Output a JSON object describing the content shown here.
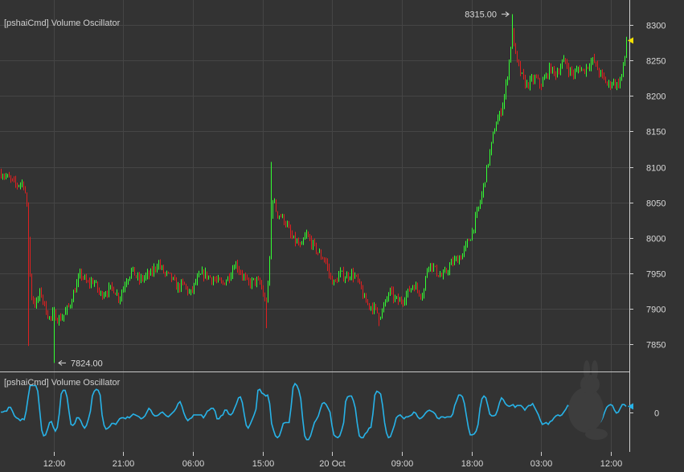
{
  "colors": {
    "background": "#333333",
    "grid": "#454545",
    "up": "#33ff33",
    "down": "#e02020",
    "oscillator": "#27b3e8",
    "axis_text": "#d8d8d8",
    "last_price_marker": "#f2e000",
    "osc_marker": "#27b3e8"
  },
  "chart_data": [
    {
      "type": "candlestick",
      "title": "[pshaiCmd] Volume Oscillator",
      "x_ticks": [
        "12:00",
        "21:00",
        "06:00",
        "15:00",
        "20 Oct",
        "09:00",
        "18:00",
        "03:00",
        "12:00"
      ],
      "y_ticks": [
        7850,
        7900,
        7950,
        8000,
        8050,
        8100,
        8150,
        8200,
        8250,
        8300
      ],
      "ylim": [
        7812,
        8335
      ],
      "annotations": [
        {
          "text": "8315.00",
          "value": 8315,
          "arrow": "right"
        },
        {
          "text": "7824.00",
          "value": 7824,
          "arrow": "left"
        }
      ],
      "last_value": 8278,
      "anchors": [
        [
          0,
          8092
        ],
        [
          8,
          8086
        ],
        [
          14,
          8080
        ],
        [
          20,
          8074
        ],
        [
          26,
          8078
        ],
        [
          30,
          8075
        ],
        [
          34,
          8030
        ],
        [
          38,
          7920
        ],
        [
          44,
          7905
        ],
        [
          50,
          7925
        ],
        [
          56,
          7900
        ],
        [
          62,
          7885
        ],
        [
          66,
          7895
        ],
        [
          72,
          7885
        ],
        [
          78,
          7890
        ],
        [
          86,
          7905
        ],
        [
          92,
          7925
        ],
        [
          100,
          7950
        ],
        [
          108,
          7935
        ],
        [
          116,
          7940
        ],
        [
          124,
          7920
        ],
        [
          132,
          7925
        ],
        [
          140,
          7930
        ],
        [
          148,
          7915
        ],
        [
          156,
          7940
        ],
        [
          164,
          7955
        ],
        [
          172,
          7940
        ],
        [
          180,
          7945
        ],
        [
          188,
          7950
        ],
        [
          196,
          7965
        ],
        [
          204,
          7950
        ],
        [
          212,
          7945
        ],
        [
          220,
          7930
        ],
        [
          228,
          7935
        ],
        [
          236,
          7920
        ],
        [
          244,
          7940
        ],
        [
          252,
          7950
        ],
        [
          260,
          7945
        ],
        [
          268,
          7940
        ],
        [
          276,
          7935
        ],
        [
          284,
          7945
        ],
        [
          292,
          7965
        ],
        [
          300,
          7950
        ],
        [
          308,
          7935
        ],
        [
          316,
          7940
        ],
        [
          324,
          7935
        ],
        [
          330,
          7905
        ],
        [
          334,
          7940
        ],
        [
          338,
          8060
        ],
        [
          344,
          8035
        ],
        [
          350,
          8030
        ],
        [
          356,
          8020
        ],
        [
          362,
          8000
        ],
        [
          368,
          7995
        ],
        [
          374,
          7985
        ],
        [
          380,
          8005
        ],
        [
          386,
          7995
        ],
        [
          392,
          7985
        ],
        [
          398,
          7975
        ],
        [
          404,
          7970
        ],
        [
          410,
          7945
        ],
        [
          416,
          7935
        ],
        [
          422,
          7950
        ],
        [
          430,
          7945
        ],
        [
          436,
          7950
        ],
        [
          442,
          7945
        ],
        [
          448,
          7930
        ],
        [
          454,
          7910
        ],
        [
          460,
          7905
        ],
        [
          466,
          7900
        ],
        [
          472,
          7890
        ],
        [
          478,
          7905
        ],
        [
          484,
          7925
        ],
        [
          490,
          7915
        ],
        [
          496,
          7910
        ],
        [
          502,
          7915
        ],
        [
          508,
          7925
        ],
        [
          514,
          7935
        ],
        [
          520,
          7925
        ],
        [
          526,
          7920
        ],
        [
          532,
          7965
        ],
        [
          538,
          7960
        ],
        [
          544,
          7950
        ],
        [
          550,
          7945
        ],
        [
          556,
          7955
        ],
        [
          562,
          7965
        ],
        [
          568,
          7970
        ],
        [
          574,
          7975
        ],
        [
          580,
          7990
        ],
        [
          586,
          8005
        ],
        [
          592,
          8030
        ],
        [
          598,
          8055
        ],
        [
          604,
          8090
        ],
        [
          610,
          8125
        ],
        [
          616,
          8160
        ],
        [
          622,
          8175
        ],
        [
          628,
          8205
        ],
        [
          632,
          8240
        ],
        [
          637,
          8290
        ],
        [
          642,
          8250
        ],
        [
          648,
          8230
        ],
        [
          654,
          8215
        ],
        [
          660,
          8220
        ],
        [
          666,
          8225
        ],
        [
          672,
          8215
        ],
        [
          678,
          8225
        ],
        [
          684,
          8240
        ],
        [
          690,
          8230
        ],
        [
          696,
          8240
        ],
        [
          702,
          8250
        ],
        [
          708,
          8235
        ],
        [
          714,
          8230
        ],
        [
          720,
          8240
        ],
        [
          726,
          8235
        ],
        [
          732,
          8245
        ],
        [
          738,
          8250
        ],
        [
          744,
          8235
        ],
        [
          750,
          8225
        ],
        [
          756,
          8215
        ],
        [
          762,
          8220
        ],
        [
          768,
          8215
        ],
        [
          772,
          8225
        ],
        [
          776,
          8245
        ],
        [
          779,
          8278
        ]
      ]
    },
    {
      "type": "line",
      "title": "[pshaiCmd] Volume Oscillator",
      "y_ticks": [
        0
      ],
      "ylim": [
        -42,
        42
      ],
      "series": [
        {
          "values": [
            0,
            0,
            1,
            1,
            5,
            5,
            1,
            -4,
            -6,
            -7,
            -9,
            -7,
            -8,
            1,
            15,
            28,
            28,
            28,
            28,
            22,
            1,
            -19,
            -25,
            -24,
            -18,
            -11,
            -10,
            -16,
            -20,
            -16,
            -2,
            19,
            23,
            23,
            16,
            1,
            -13,
            -14,
            -12,
            -6,
            -6,
            -9,
            -14,
            -17,
            -14,
            -7,
            1,
            17,
            22,
            24,
            23,
            18,
            -3,
            -14,
            -18,
            -17,
            -15,
            -12,
            -12,
            -13,
            -10,
            -7,
            -6,
            -6,
            -7,
            -5,
            -6,
            -4,
            -2,
            -3,
            -4,
            -5,
            -7,
            -6,
            -4,
            0,
            4,
            2,
            -2,
            -4,
            -4,
            -3,
            -1,
            0,
            -2,
            -4,
            -5,
            -3,
            -1,
            1,
            4,
            9,
            11,
            6,
            -1,
            -6,
            -9,
            -7,
            -6,
            -3,
            -3,
            -3,
            -3,
            -3,
            -6,
            -3,
            1,
            2,
            4,
            4,
            1,
            -7,
            -7,
            -4,
            -3,
            2,
            2,
            -2,
            -3,
            -1,
            4,
            9,
            15,
            16,
            10,
            -3,
            -14,
            -17,
            -13,
            -8,
            -3,
            3,
            23,
            24,
            20,
            19,
            17,
            18,
            9,
            -12,
            -19,
            -25,
            -27,
            -25,
            -19,
            -12,
            -11,
            -11,
            -11,
            5,
            26,
            30,
            28,
            23,
            14,
            -8,
            -25,
            -29,
            -29,
            -25,
            -18,
            -11,
            -8,
            -4,
            3,
            9,
            10,
            8,
            4,
            0,
            -14,
            -24,
            -26,
            -27,
            -25,
            -19,
            -11,
            11,
            16,
            17,
            17,
            12,
            4,
            -12,
            -25,
            -27,
            -27,
            -23,
            -21,
            -17,
            -16,
            -2,
            18,
            22,
            21,
            19,
            7,
            -11,
            -22,
            -27,
            -26,
            -20,
            -14,
            -6,
            -4,
            -3,
            -5,
            -7,
            -5,
            -5,
            -4,
            -3,
            0,
            -1,
            -5,
            -7,
            -6,
            -4,
            -1,
            1,
            2,
            1,
            0,
            -2,
            -6,
            -7,
            -5,
            -5,
            -6,
            -5,
            -5,
            -5,
            -2,
            7,
            12,
            18,
            18,
            16,
            9,
            -4,
            -16,
            -24,
            -24,
            -23,
            -20,
            -13,
            4,
            14,
            17,
            15,
            7,
            -2,
            -4,
            -4,
            -3,
            2,
            10,
            15,
            13,
            9,
            7,
            6,
            7,
            8,
            5,
            7,
            7,
            7,
            5,
            2,
            5,
            7,
            7,
            9,
            5,
            1,
            -3,
            -9,
            -13,
            -12,
            -11,
            -13,
            -10,
            -9,
            -6,
            -4,
            -3,
            -4,
            -3,
            0,
            3,
            7,
            6,
            0,
            3,
            6,
            5,
            2,
            1,
            3,
            8,
            9,
            9,
            8,
            4,
            -2,
            -9,
            -12,
            -10,
            -6,
            0,
            5,
            7,
            8,
            7,
            2,
            -1,
            0,
            4,
            8,
            8,
            6
          ]
        }
      ],
      "last_value": 6
    }
  ]
}
